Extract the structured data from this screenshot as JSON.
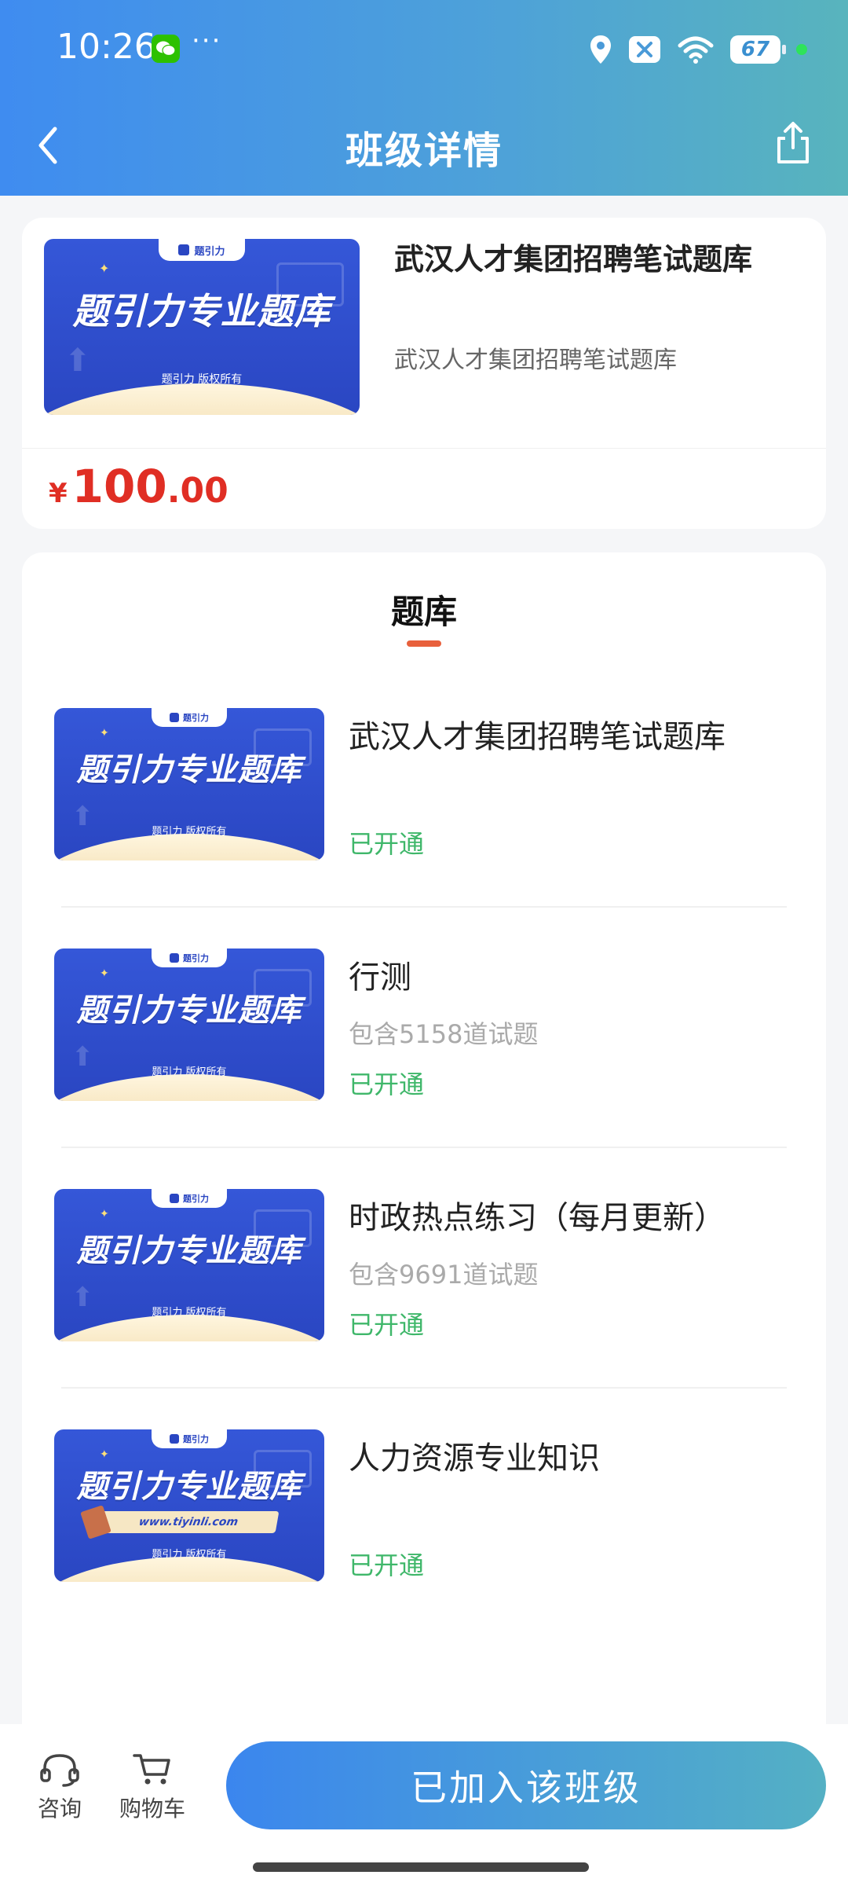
{
  "status_bar": {
    "time": "10:26",
    "dots": "···",
    "battery": "67"
  },
  "nav": {
    "title": "班级详情"
  },
  "product": {
    "title": "武汉人才集团招聘笔试题库",
    "subtitle": "武汉人才集团招聘笔试题库",
    "price_symbol": "¥",
    "price_integer": "100",
    "price_decimal": ".00"
  },
  "banner": {
    "tag": "题引力",
    "slogan": "题引力专业题库",
    "copyright": "题引力 版权所有",
    "url": "www.tiyinli.com"
  },
  "section": {
    "tab": "题库"
  },
  "items": [
    {
      "title": "武汉人才集团招聘笔试题库",
      "subtitle": "",
      "status": "已开通"
    },
    {
      "title": "行测",
      "subtitle": "包含5158道试题",
      "status": "已开通"
    },
    {
      "title": "时政热点练习（每月更新）",
      "subtitle": "包含9691道试题",
      "status": "已开通"
    },
    {
      "title": "人力资源专业知识",
      "subtitle": "",
      "status": "已开通"
    }
  ],
  "bottom_bar": {
    "consult_label": "咨询",
    "cart_label": "购物车",
    "join_label": "已加入该班级"
  },
  "colors": {
    "accent": "#3f8cf0",
    "price": "#e02e24",
    "status_green": "#3fb76a",
    "tab_underline": "#e8603c"
  }
}
